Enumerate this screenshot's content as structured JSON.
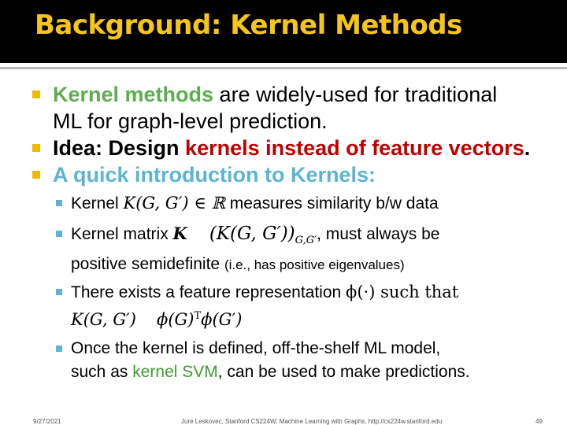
{
  "title": "Background: Kernel Methods",
  "bullets": {
    "b1": {
      "highlight": "Kernel methods",
      "line1_rest": " are widely-used for traditional",
      "line2": "ML for graph-level prediction."
    },
    "b2": {
      "prefix": "Idea: Design ",
      "highlight": "kernels instead of feature vectors",
      "suffix": "."
    },
    "b3": {
      "text": "A quick introduction to Kernels:"
    }
  },
  "sub_bullets": {
    "s1": {
      "label": "Kernel ",
      "math": "K(G, G′) ∈ ℝ",
      "rest": "  measures similarity b/w data"
    },
    "s2": {
      "label": "Kernel matrix ",
      "bold_k": "K",
      "math": "(K(G, G′))",
      "subscript": "G,G′",
      "rest": ", must always be",
      "line2_main": "positive semidefinite ",
      "line2_small": "(i.e., has positive eigenvalues)"
    },
    "s3": {
      "text": "There exists a feature representation ",
      "math": "ϕ(·) such that",
      "line2_a": "K(G, G′)",
      "line2_b": "ϕ(G)",
      "line2_sup": "T",
      "line2_c": "ϕ(G′)"
    },
    "s4": {
      "line1": "Once the kernel is defined, off-the-shelf ML model,",
      "line2_pre": "such as ",
      "line2_highlight": "kernel SVM",
      "line2_post": ", can be used to make predictions."
    }
  },
  "footer": {
    "date": "9/27/2021",
    "credit": "Jure Leskovec, Stanford CS224W: Machine Learning with Graphs, http://cs224w.stanford.edu",
    "page": "49"
  },
  "colors": {
    "title": "#F5C518",
    "title_bar": "#000000",
    "green": "#5DAE4F",
    "red": "#C00000",
    "blue": "#5BB4D4",
    "bullet_main": "#F0B90B"
  }
}
